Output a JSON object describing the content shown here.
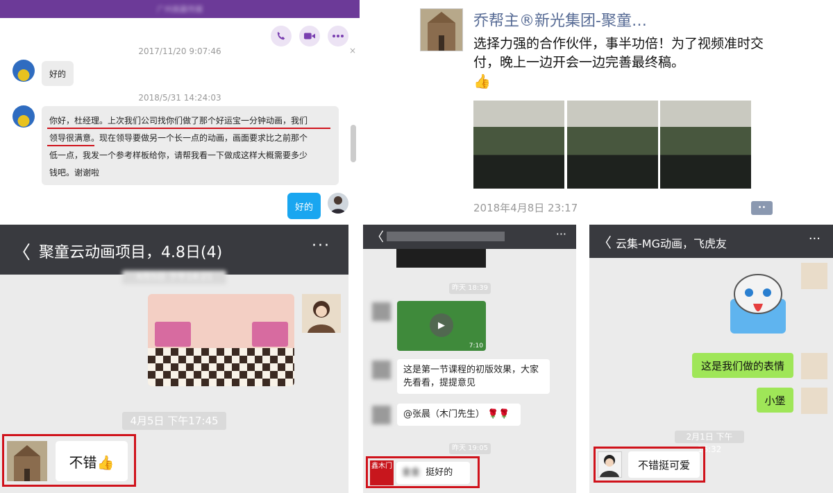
{
  "panel_a": {
    "window_title": "广州高赢传媒",
    "actions": [
      "phone-icon",
      "video-icon",
      "more-icon"
    ],
    "timestamp1": "2017/11/20 9:07:46",
    "msg1": "好的",
    "timestamp2": "2018/5/31 14:24:03",
    "msg2_lines": [
      "你好，杜经理。上次我们公司找你们做了那个好运宝一分钟动画，我们",
      "领导很满意。现在领导要做另一个长一点的动画，画面要求比之前那个",
      "低一点，我发一个参考样板给你，请帮我看一下做成这样大概需要多少",
      "钱吧。谢谢啦"
    ],
    "reply": "好的",
    "close_glyph": "×"
  },
  "panel_b": {
    "name": "乔帮主®新光集团-聚童…",
    "text": "选择力强的合作伙伴，事半功倍！为了视频准时交付，晚上一边开会一边完善最终稿。",
    "thumb": "👍",
    "date": "2018年4月8日 23:17",
    "comment_glyph": "••"
  },
  "panel_c": {
    "back": "〈",
    "title": "聚童云动画项目，4.8日(4)",
    "more": "···",
    "top_time": "4月5日 下午14:21",
    "time2": "4月5日 下午17:45",
    "reply": "不错👍"
  },
  "panel_d": {
    "back": "〈",
    "more": "···",
    "time1": "昨天 18:39",
    "video_duration": "7:10",
    "msg1": "这是第一节课程的初版效果，大家先看看，提提意见",
    "msg2": "@张晨（木门先生） 🌹🌹",
    "time2": "昨天 19:05",
    "seal": "鑫木门",
    "reply_name": "金金",
    "reply": "挺好的"
  },
  "panel_e": {
    "back": "〈",
    "title": "云集-MG动画，飞虎友",
    "more": "···",
    "msg1": "这是我们做的表情",
    "msg2": "小堡",
    "time": "2月1日 下午16:32",
    "reply": "不错挺可爱"
  }
}
